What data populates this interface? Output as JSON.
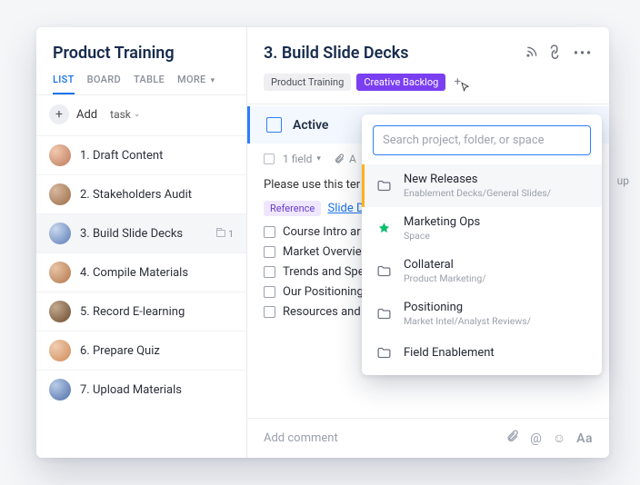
{
  "sidebar": {
    "title": "Product Training",
    "tabs": {
      "list": "LIST",
      "board": "BOARD",
      "table": "TABLE",
      "more": "MORE"
    },
    "add": {
      "label": "Add",
      "type_label": "task"
    },
    "tasks": [
      {
        "label": "1. Draft Content"
      },
      {
        "label": "2. Stakeholders Audit"
      },
      {
        "label": "3. Build Slide Decks",
        "folder_count": "1"
      },
      {
        "label": "4. Compile Materials"
      },
      {
        "label": "5. Record E-learning"
      },
      {
        "label": "6. Prepare Quiz"
      },
      {
        "label": "7. Upload Materials"
      }
    ]
  },
  "main": {
    "title": "3. Build Slide Decks",
    "tags": {
      "a": "Product Training",
      "b": "Creative Backlog"
    },
    "status": "Active",
    "meta": {
      "fields": "1 field",
      "attach": "A"
    },
    "truncated_right": "up",
    "desc_prompt": "Please use this ter",
    "reference": {
      "chip": "Reference",
      "link": "Slide D"
    },
    "checklist": [
      "Course Intro ar",
      "Market Overvie",
      "Trends and Spe",
      "Our Positioning",
      "Resources and Contacts"
    ],
    "comment_placeholder": "Add comment",
    "aa": "Aa"
  },
  "dropdown": {
    "search_placeholder": "Search project, folder, or space",
    "items": [
      {
        "title": "New Releases",
        "sub": "Enablement Decks/General Slides/",
        "icon": "folder",
        "selected": true
      },
      {
        "title": "Marketing Ops",
        "sub": "Space",
        "icon": "space"
      },
      {
        "title": "Collateral",
        "sub": "Product Marketing/",
        "icon": "folder"
      },
      {
        "title": "Positioning",
        "sub": "Market Intel/Analyst Reviews/",
        "icon": "folder"
      },
      {
        "title": "Field Enablement",
        "sub": "",
        "icon": "folder"
      }
    ]
  }
}
